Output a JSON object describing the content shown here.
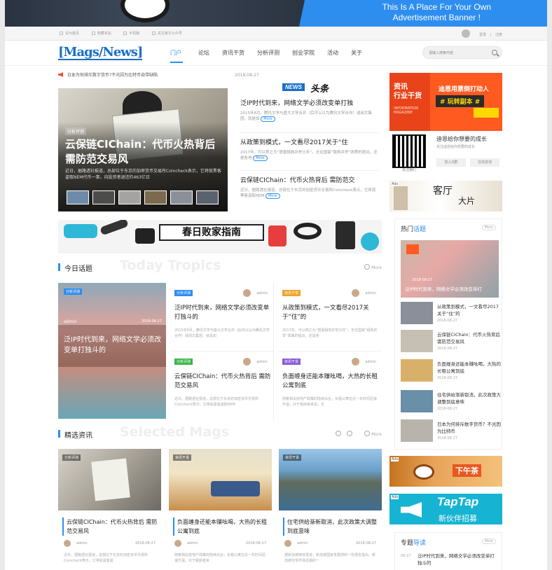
{
  "banner": {
    "line1": "This Is A Place For Your Own",
    "line2": "Advertisement Banner !"
  },
  "topbar": {
    "links": [
      "设为首页",
      "收藏本站",
      "手机版",
      "关注官方公众号"
    ],
    "login": "登录",
    "register": "注册"
  },
  "header": {
    "logo": "[Mags/News]",
    "nav": [
      "门户",
      "论坛",
      "资讯干货",
      "分析评测",
      "创业学院",
      "活动",
      "关于"
    ],
    "search_placeholder": "请输入搜索内容"
  },
  "notice": {
    "text": "日本为何排斥数字货币?不光因为比特币自带缺陷",
    "date": "2018-08-27"
  },
  "slider": {
    "tag": "分析评测",
    "title": "云保链CIChain：代币火热背后 需防范交易风",
    "desc": "近日，据路透社报道，总部位于东京的加密货币交易所Coincheck表示，它将就黑客盗取NEM代币一事，向投资者退还约463亿日"
  },
  "headline": {
    "news": "NEWS",
    "toutiao": "头条",
    "items": [
      {
        "title": "泛IP时代到来，网络文学必须改变单打独",
        "desc": "2015年8月，腾讯文学与盛大文学合并（后可以以为腾讯文学合作）成阅文集团，就是如",
        "more": "More"
      },
      {
        "title": "从政策到模式，一文看尽2017关于“住",
        "desc": "2017年，可以称之为“居屋租购并举元年”。无论国家“租购并举”政策的提出，还是各地",
        "more": "More"
      },
      {
        "title": "云保链CIChain：代币火热背后 需防范交",
        "desc": "近日，据路透社报道，总部位于东京的加密货币交易所Coincheck表示，它将就黑客盗取NEM",
        "more": "More"
      }
    ]
  },
  "right": {
    "ad1": {
      "left_a": "资讯",
      "left_b": "行业干货",
      "left_c": "INFORMATION MAGAZINE",
      "r1": "迪恩用票倒打动人",
      "r2": "# 玩转副本 #"
    },
    "qr_label": "关注我们",
    "follow_title": "迪恩给你想要的成长",
    "follow_sub": "关注迪恩给你想要的成长",
    "follow_btn1": "加入Q群",
    "follow_btn2": "在线咨询",
    "ad2": {
      "ads": "Ads",
      "t1": "客厅",
      "t2": "大片"
    }
  },
  "sale": {
    "title": "春日败家指南"
  },
  "today": {
    "cn": "今日话题",
    "en": "Today Tropics",
    "more": "More",
    "big": {
      "tag": "分析评测",
      "author": "admin",
      "date": "2018-08-27",
      "title": "泛IP时代到来，网络文学必须改变单打独斗的"
    },
    "cards": [
      {
        "tag": "分析评测",
        "author": "admin",
        "title": "泛IP时代到来，网络文学必须改变单打独斗的",
        "desc": "2015年8月，腾讯文学与盛大文学合并（后可以以为腾讯文学合作）成阅文集团，就是如"
      },
      {
        "tag": "资讯干货",
        "author": "admin",
        "title": "从政策到模式，一文看尽2017关于“住”的",
        "desc": "2017年，可以称之为“居屋租购并举元年”。无论国家“租购并举”政策的提出，还是各"
      },
      {
        "tag": "分析评测",
        "author": "admin",
        "title": "云保链CIChain：代币火热背后 需防范交易风",
        "desc": "近日，据路透社报道，总部位于东京的加密货币交易所Coincheck表示，它将就黑客盗取NEM"
      },
      {
        "tag": "资讯干货",
        "author": "admin",
        "title": "负面缠身还能本赚吆喝，大热的长租公寓到底",
        "desc": "随着相关房地产政策的陆续出台，长租公寓在近一年时间迅速升温，对于租房者来说，长"
      }
    ]
  },
  "featured": {
    "cn": "精选资讯",
    "en": "Selected Mags",
    "more": "More",
    "cards": [
      {
        "tag": "分析评测",
        "title": "云保链CIChain：代币火热背后 需防范交易风",
        "author": "admin",
        "date": "2018-08-27",
        "desc": "近日，据路透社报道，总部位于东京的加密货币交易所Coincheck表示，它将就黑客盗"
      },
      {
        "tag": "资讯干货",
        "title": "负面缠身还能本赚吆喝，大热的长租公寓到底",
        "author": "admin",
        "date": "2018-08-27",
        "desc": "随着相关房地产政策的陆续出台，长租公寓在近一年时间迅速升温，对于租房者来"
      },
      {
        "tag": "资讯干货",
        "title": "住宅供给渐新取消，此次政策大调整到底意味",
        "author": "admin",
        "date": "2018-08-27",
        "desc": "据新加坡媒体报道，新加坡国家发展部的一份报告指出，新加坡住宅市场近期的一"
      }
    ]
  },
  "hot": {
    "title_a": "热门",
    "title_b": "话题",
    "more": "More",
    "big": {
      "date": "2018-08-27",
      "title": "泛IP时代到来，网络文学必须改变单打"
    },
    "items": [
      {
        "title": "从政策到模式，一文看尽2017关于“住”的",
        "date": "2018-08-27"
      },
      {
        "title": "云保链CIChain：代币火热背后 需防范交易风",
        "date": "2018-08-27"
      },
      {
        "title": "负面缠身还能本赚吆喝，大热的长租公寓到底",
        "date": "2018-08-27"
      },
      {
        "title": "住宅供给渐新取消，此次政策大调整到底意味",
        "date": "2018-08-27"
      },
      {
        "title": "日本为何排斥数字货币？不光因为比特币",
        "date": "2018-08-27"
      }
    ]
  },
  "ad3": {
    "ads": "Ads",
    "text": "下午茶"
  },
  "ad4": {
    "ads": "Ads",
    "t1": "TapTap",
    "t2": "新伙伴招募"
  },
  "topic": {
    "title_a": "专题",
    "title_b": "导读",
    "more": "More",
    "date": "08-27",
    "text": "泛IP时代到来，网络文学必须改变单打独斗的"
  }
}
